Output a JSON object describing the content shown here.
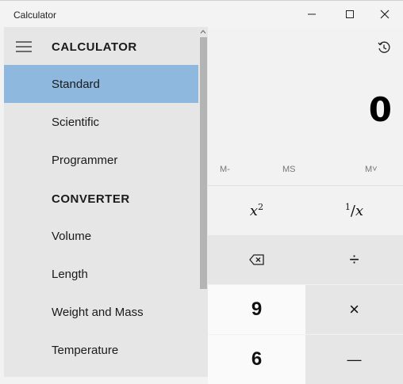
{
  "window": {
    "title": "Calculator",
    "controls": [
      "minimize",
      "maximize",
      "close"
    ]
  },
  "nav": {
    "header_calculator": "CALCULATOR",
    "header_converter": "CONVERTER",
    "items": [
      {
        "label": "Standard",
        "selected": true
      },
      {
        "label": "Scientific"
      },
      {
        "label": "Programmer"
      },
      {
        "label": "Volume"
      },
      {
        "label": "Length"
      },
      {
        "label": "Weight and Mass"
      },
      {
        "label": "Temperature"
      }
    ]
  },
  "calculator": {
    "display": "0",
    "memory": {
      "mminus": "M-",
      "ms": "MS",
      "mstar": "M˅"
    },
    "keys": {
      "square_base": "x",
      "square_exp": "2",
      "reciprocal_num": "1",
      "reciprocal_den": "x",
      "divide": "÷",
      "multiply": "×",
      "minus": "—",
      "nine": "9",
      "six": "6"
    }
  },
  "colors": {
    "selected_nav": "#8fb8de",
    "nav_bg": "#e6e6e6",
    "app_bg": "#f2f2f2"
  }
}
